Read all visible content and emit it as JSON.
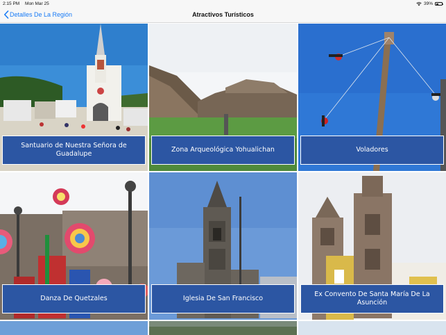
{
  "status_bar": {
    "time": "2:15 PM",
    "date": "Mon Mar 25",
    "battery_percent": "39%",
    "battery_level": 0.39
  },
  "nav": {
    "back_label": "Detalles De La Región",
    "title": "Atractivos Turísticos"
  },
  "attractions": [
    {
      "name": "Santuario de Nuestra Señora de Guadalupe"
    },
    {
      "name": "Zona Arqueológica Yohualichan"
    },
    {
      "name": "Voladores"
    },
    {
      "name": "Danza De Quetzales"
    },
    {
      "name": "Iglesia De San Francisco"
    },
    {
      "name": "Ex Convento De Santa María De La Asunción"
    }
  ],
  "colors": {
    "accent": "#1a7cf6",
    "label_background": "#2c56a3",
    "nav_background": "#f7f7f7"
  }
}
